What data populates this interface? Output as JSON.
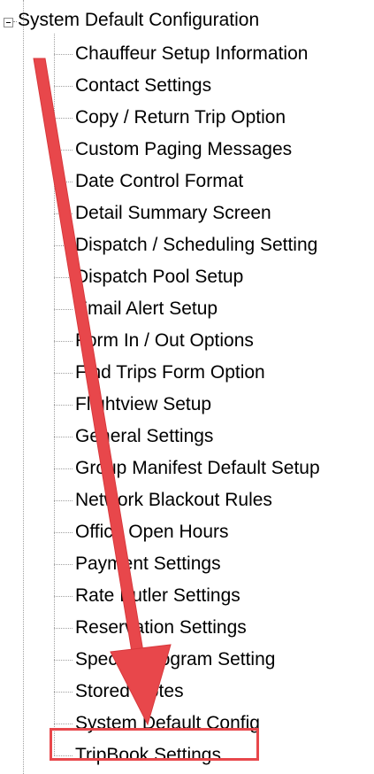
{
  "tree": {
    "root_label": "System Default Configuration",
    "items": [
      "Chauffeur Setup Information",
      "Contact Settings",
      "Copy / Return Trip Option",
      "Custom Paging Messages",
      "Date Control Format",
      "Detail Summary Screen",
      "Dispatch / Scheduling Setting",
      "Dispatch Pool Setup",
      "Email Alert Setup",
      "Form In / Out Options",
      "Find Trips Form Option",
      "Flightview Setup",
      "General Settings",
      "Group Manifest Default Setup",
      "Network Blackout Rules",
      "Office Open Hours",
      "Payment Settings",
      "Rate Butler Settings",
      "Reservation Settings",
      "Special Program Setting",
      "Stored Notes",
      "System Default Config",
      "TripBook Settings"
    ]
  },
  "annotation": {
    "arrow_color": "#e8474b",
    "highlight_color": "#e8474b"
  }
}
